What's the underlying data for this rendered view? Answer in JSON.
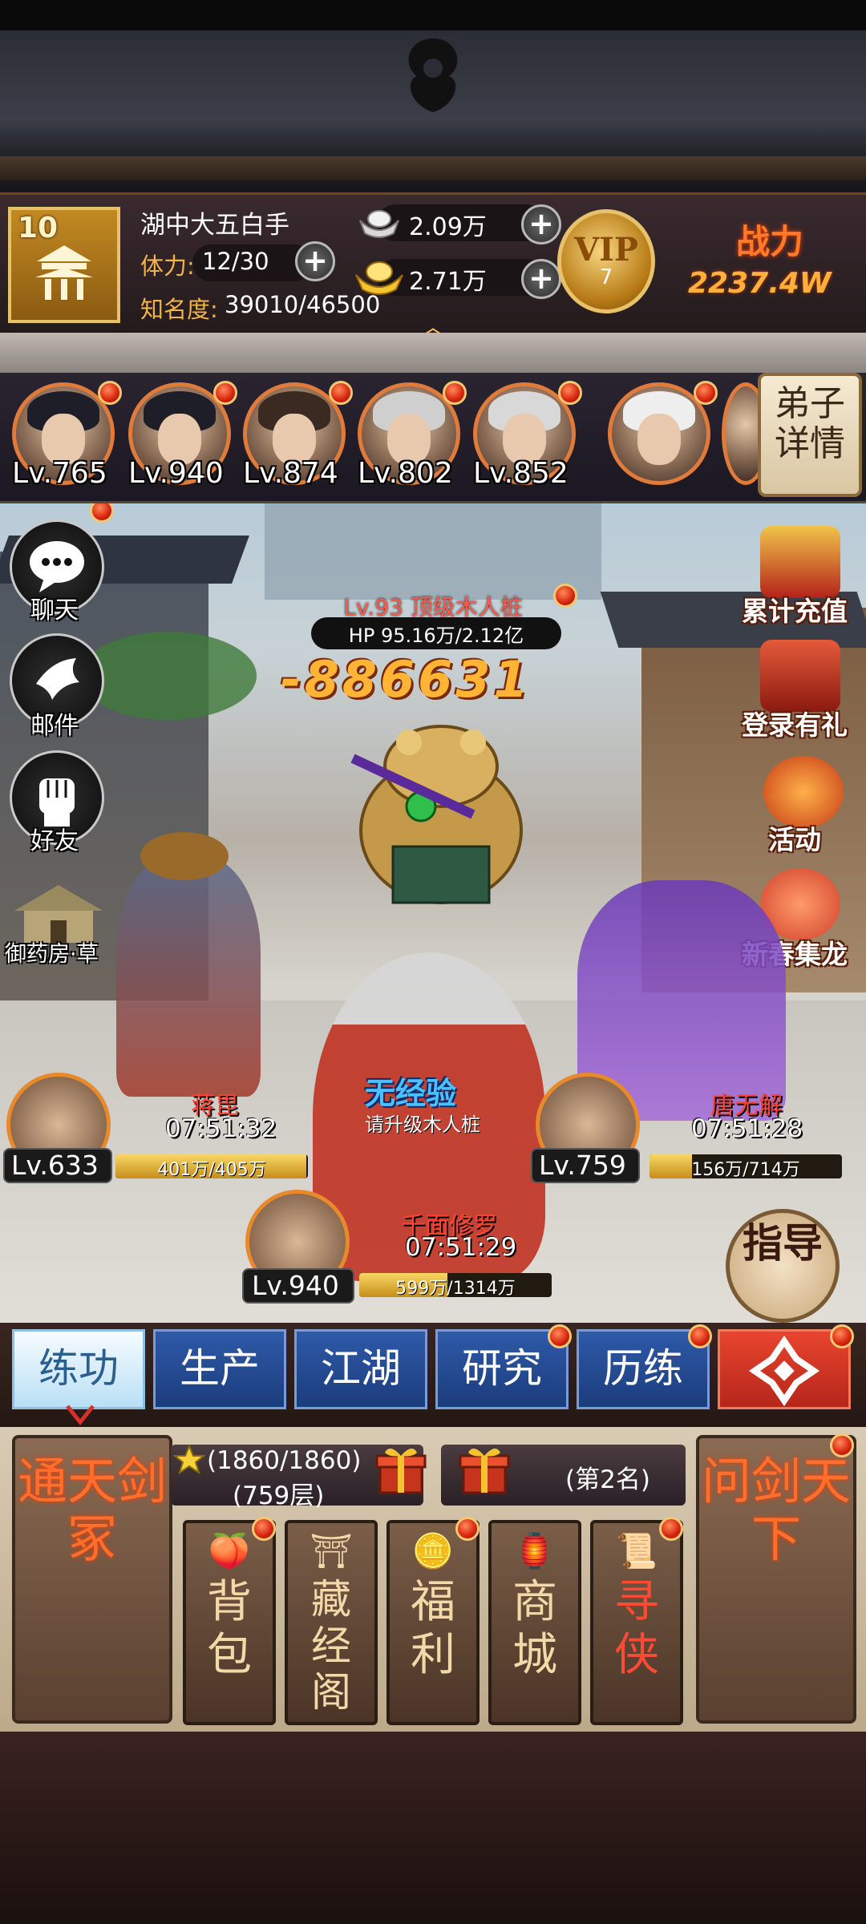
{
  "player": {
    "level": "10",
    "name": "湖中大五白手",
    "stamina_label": "体力:",
    "stamina_value": "12/30",
    "fame_label": "知名度:",
    "fame_value": "39010/46500"
  },
  "currency": {
    "silver": "2.09万",
    "gold": "2.71万"
  },
  "vip": {
    "label": "VIP",
    "level": "7"
  },
  "power": {
    "label": "战力",
    "value": "2237.4W"
  },
  "disciples": [
    {
      "level": "Lv.765"
    },
    {
      "level": "Lv.940"
    },
    {
      "level": "Lv.874"
    },
    {
      "level": "Lv.802"
    },
    {
      "level": "Lv.852"
    },
    {
      "level": ""
    }
  ],
  "disciple_detail_label": "弟子详情",
  "left_menu": {
    "chat": "聊天",
    "mail": "邮件",
    "friends": "好友",
    "pharmacy": "御药房·草"
  },
  "right_menu": {
    "recharge": "累计充值",
    "login_gift": "登录有礼",
    "activity": "活动",
    "new_year": "新春集龙"
  },
  "boss": {
    "title": "Lv.93 顶级木人桩",
    "hp": "HP 95.16万/2.12亿",
    "damage": "-886631"
  },
  "heroes": [
    {
      "name": "蒋毘",
      "timer": "07:51:32",
      "level": "Lv.633",
      "hp": "401万/405万",
      "fill": 0.99
    },
    {
      "name": "唐无解",
      "timer": "07:51:28",
      "level": "Lv.759",
      "hp": "156万/714万",
      "fill": 0.22
    },
    {
      "name": "千面修罗",
      "timer": "07:51:29",
      "level": "Lv.940",
      "hp": "599万/1314万",
      "fill": 0.46
    }
  ],
  "no_exp": {
    "title": "无经验",
    "subtitle": "请升级木人桩"
  },
  "guide_label": "指导",
  "tabs": [
    {
      "label": "练功"
    },
    {
      "label": "生产"
    },
    {
      "label": "江湖"
    },
    {
      "label": "研究"
    },
    {
      "label": "历练"
    }
  ],
  "panel": {
    "left_big": "通天剑冢",
    "right_big": "问剑天下",
    "tower_progress": "(1860/1860)",
    "tower_floor": "(759层)",
    "rank": "(第2名)",
    "cards": [
      {
        "label": "背包",
        "icon": "peach-icon"
      },
      {
        "label": "藏经阁",
        "icon": "pavilion-icon"
      },
      {
        "label": "福利",
        "icon": "coin-icon"
      },
      {
        "label": "商城",
        "icon": "shop-icon"
      },
      {
        "label": "寻侠",
        "icon": "scroll-icon"
      }
    ]
  },
  "colors": {
    "accent": "#e07b3c",
    "tab_blue": "#2e5aa8",
    "notify_red": "#d6230e"
  }
}
